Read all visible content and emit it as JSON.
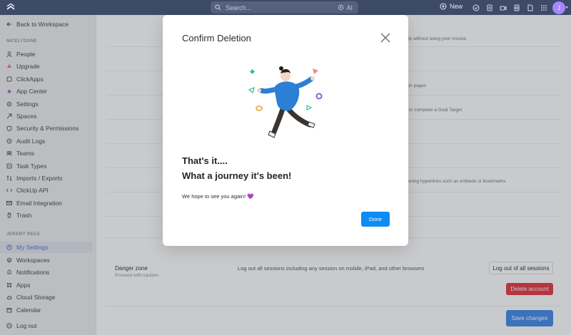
{
  "topbar": {
    "search_placeholder": "Search...",
    "ai_label": "AI",
    "new_label": "New",
    "avatar_initial": "J"
  },
  "sidebar": {
    "back_label": "Back to Workspace",
    "workspace_section": "NICELYDONE",
    "workspace_items": [
      {
        "label": "People",
        "icon": "person-icon"
      },
      {
        "label": "Upgrade",
        "icon": "upgrade-icon"
      },
      {
        "label": "ClickApps",
        "icon": "clickapps-icon"
      },
      {
        "label": "App Center",
        "icon": "app-center-icon"
      },
      {
        "label": "Settings",
        "icon": "gear-icon"
      },
      {
        "label": "Spaces",
        "icon": "spaces-icon"
      },
      {
        "label": "Security & Permissions",
        "icon": "shield-icon"
      },
      {
        "label": "Audit Logs",
        "icon": "audit-icon"
      },
      {
        "label": "Teams",
        "icon": "teams-icon"
      },
      {
        "label": "Task Types",
        "icon": "task-types-icon"
      },
      {
        "label": "Imports / Exports",
        "icon": "import-export-icon"
      },
      {
        "label": "ClickUp API",
        "icon": "api-icon"
      },
      {
        "label": "Email Integration",
        "icon": "email-icon"
      },
      {
        "label": "Trash",
        "icon": "trash-icon"
      }
    ],
    "user_section": "JEREMY REES",
    "user_items": [
      {
        "label": "My Settings",
        "icon": "user-settings-icon",
        "active": true
      },
      {
        "label": "Workspaces",
        "icon": "workspaces-icon"
      },
      {
        "label": "Notifications",
        "icon": "bell-icon"
      },
      {
        "label": "Apps",
        "icon": "apps-icon"
      },
      {
        "label": "Cloud Storage",
        "icon": "cloud-icon"
      },
      {
        "label": "Calendar",
        "icon": "calendar-icon"
      }
    ],
    "logout_label": "Log out"
  },
  "main": {
    "faint_texts": [
      "Up without using your mouse.",
      "ain pages",
      ", or complete a Goal Target",
      "during hyperlinks such as embeds or bookmarks"
    ],
    "danger_title": "Danger zone",
    "danger_sub": "Proceed with caution.",
    "danger_desc": "Log out all sessions including any session on mobile, iPad, and other browsers",
    "logout_all_label": "Log out of all sessions",
    "delete_label": "Delete account",
    "save_label": "Save changes"
  },
  "modal": {
    "title": "Confirm Deletion",
    "heading1": "That's it....",
    "heading2": "What a journey it's been!",
    "message": "We hope to see you again! 💜",
    "done_label": "Done"
  },
  "colors": {
    "topbar": "#3d4b69",
    "accent": "#0f8cf3",
    "danger": "#e3333b",
    "active_nav": "#5b6bd6"
  }
}
